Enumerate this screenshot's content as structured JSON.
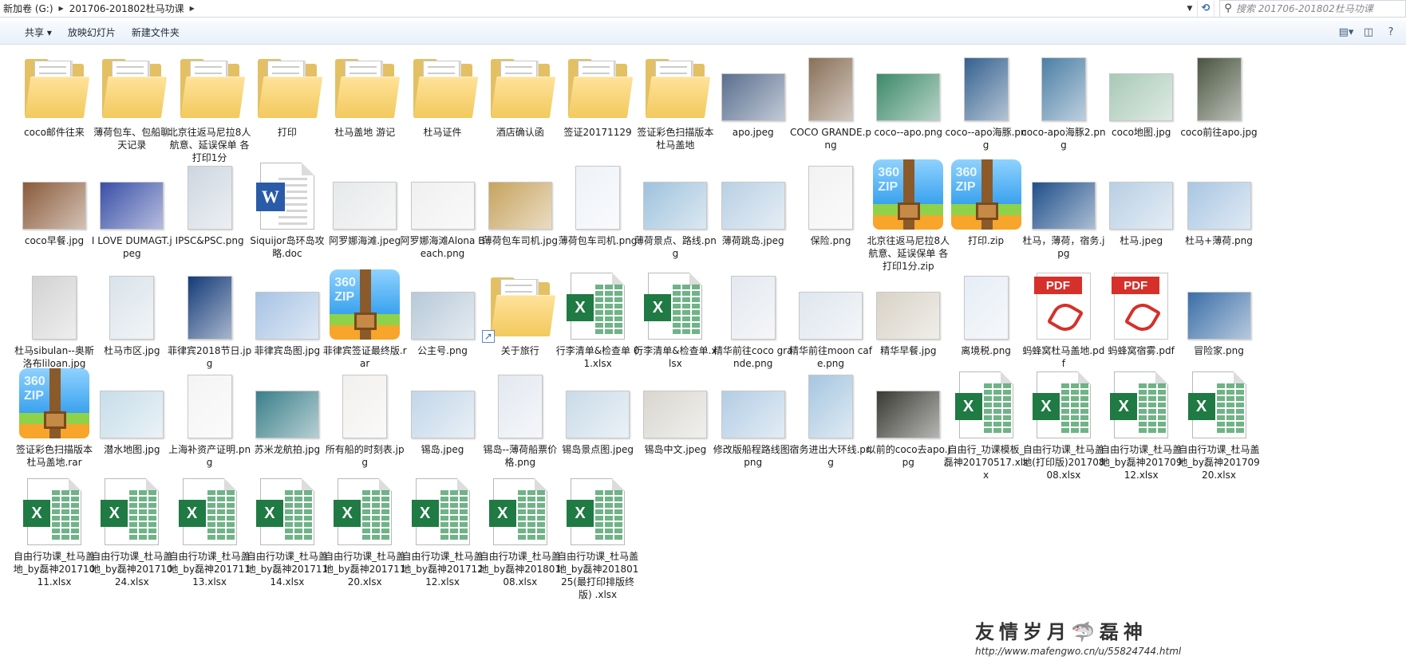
{
  "address": {
    "crumbs": [
      "新加卷 (G:)",
      "201706-201802杜马功课"
    ],
    "search_placeholder": "搜索 201706-201802杜马功课"
  },
  "toolbar": {
    "share": "共享 ▾",
    "slideshow": "放映幻灯片",
    "new_folder": "新建文件夹"
  },
  "items": [
    {
      "label": "coco邮件往来",
      "type": "folder"
    },
    {
      "label": "薄荷包车、包船聊天记录",
      "type": "folder"
    },
    {
      "label": "北京往返马尼拉8人 航意、延误保单 各打印1分",
      "type": "folder"
    },
    {
      "label": "打印",
      "type": "folder"
    },
    {
      "label": "杜马盖地 游记",
      "type": "folder"
    },
    {
      "label": "杜马证件",
      "type": "folder"
    },
    {
      "label": "酒店确认函",
      "type": "folder"
    },
    {
      "label": "签证20171129",
      "type": "folder"
    },
    {
      "label": "签证彩色扫描版本 杜马盖地",
      "type": "folder"
    },
    {
      "label": "apo.jpeg",
      "type": "image",
      "color": "#5a6f8f"
    },
    {
      "label": "COCO GRANDE.png",
      "type": "image",
      "color": "#8a7058",
      "tall": true
    },
    {
      "label": "coco--apo.png",
      "type": "image",
      "color": "#3d8a6a"
    },
    {
      "label": "coco--apo海豚.png",
      "type": "image",
      "color": "#35618f",
      "tall": true
    },
    {
      "label": "coco-apo海豚2.png",
      "type": "image",
      "color": "#4c7fa6",
      "tall": true
    },
    {
      "label": "coco地图.jpg",
      "type": "image",
      "color": "#a8c9b6"
    },
    {
      "label": "coco前往apo.jpg",
      "type": "image",
      "color": "#4a5540",
      "tall": true
    },
    {
      "label": "coco早餐.jpg",
      "type": "image",
      "color": "#8a5a3a"
    },
    {
      "label": "I LOVE DUMAGT.jpeg",
      "type": "image",
      "color": "#3a4fa8"
    },
    {
      "label": "IPSC&PSC.png",
      "type": "image",
      "color": "#cdd6e0",
      "tall": true
    },
    {
      "label": "Siquijor岛环岛攻略.doc",
      "type": "word"
    },
    {
      "label": "阿罗娜海滩.jpeg",
      "type": "image",
      "color": "#e6e9ea"
    },
    {
      "label": "阿罗娜海滩Alona Beach.png",
      "type": "image",
      "color": "#f0f0f0"
    },
    {
      "label": "薄荷包车司机.jpg",
      "type": "image",
      "color": "#c7a35e"
    },
    {
      "label": "薄荷包车司机.png",
      "type": "image",
      "color": "#eef2f8",
      "tall": true
    },
    {
      "label": "薄荷景点、路线.png",
      "type": "image",
      "color": "#9fc2dd"
    },
    {
      "label": "薄荷跳岛.jpeg",
      "type": "image",
      "color": "#b9d0e4"
    },
    {
      "label": "保险.png",
      "type": "image",
      "color": "#f2f2f2",
      "tall": true
    },
    {
      "label": "北京往返马尼拉8人 航意、延误保单 各打印1分.zip",
      "type": "zip"
    },
    {
      "label": "打印.zip",
      "type": "zip"
    },
    {
      "label": "杜马，薄荷，宿务.jpg",
      "type": "image",
      "color": "#1f4f8a"
    },
    {
      "label": "杜马.jpeg",
      "type": "image",
      "color": "#b8cfe4"
    },
    {
      "label": "杜马+薄荷.png",
      "type": "image",
      "color": "#a9c6e2"
    },
    {
      "label": "杜马sibulan--奥斯洛布liloan.jpg",
      "type": "image",
      "color": "#d2d2d2",
      "tall": true
    },
    {
      "label": "杜马市区.jpg",
      "type": "image",
      "color": "#d9e3ea",
      "tall": true
    },
    {
      "label": "菲律宾2018节日.jpg",
      "type": "image",
      "color": "#143b78",
      "tall": true
    },
    {
      "label": "菲律宾岛图.jpg",
      "type": "image",
      "color": "#a7c3e4"
    },
    {
      "label": "菲律宾签证最终版.rar",
      "type": "zip"
    },
    {
      "label": "公主号.png",
      "type": "image",
      "color": "#b7c9d8"
    },
    {
      "label": "关于旅行",
      "type": "folder",
      "shortcut": true
    },
    {
      "label": "行李清单&检查单 01.xlsx",
      "type": "excel"
    },
    {
      "label": "行李清单&检查单.xlsx",
      "type": "excel"
    },
    {
      "label": "精华前往coco grande.png",
      "type": "image",
      "color": "#e4e8ef",
      "tall": true
    },
    {
      "label": "精华前往moon cafe.png",
      "type": "image",
      "color": "#dfe6ee"
    },
    {
      "label": "精华早餐.jpg",
      "type": "image",
      "color": "#d8d2c6"
    },
    {
      "label": "离境税.png",
      "type": "image",
      "color": "#e6edf5",
      "tall": true
    },
    {
      "label": "蚂蜂窝杜马盖地.pdf",
      "type": "pdf"
    },
    {
      "label": "蚂蜂窝宿雾.pdf",
      "type": "pdf"
    },
    {
      "label": "冒险家.png",
      "type": "image",
      "color": "#3b6ea8"
    },
    {
      "label": "签证彩色扫描版本 杜马盖地.rar",
      "type": "zip"
    },
    {
      "label": "潜水地图.jpg",
      "type": "image",
      "color": "#c7dde9"
    },
    {
      "label": "上海补资产证明.png",
      "type": "image",
      "color": "#f4f4f4",
      "tall": true
    },
    {
      "label": "苏米龙航拍.jpg",
      "type": "image",
      "color": "#3a7f8a"
    },
    {
      "label": "所有船的时刻表.jpg",
      "type": "image",
      "color": "#f2f0ee",
      "tall": true
    },
    {
      "label": "锡岛.jpeg",
      "type": "image",
      "color": "#c2d6e8"
    },
    {
      "label": "锡岛--薄荷船票价格.png",
      "type": "image",
      "color": "#e3e8f0",
      "tall": true
    },
    {
      "label": "锡岛景点图.jpeg",
      "type": "image",
      "color": "#c9dbe8"
    },
    {
      "label": "锡岛中文.jpeg",
      "type": "image",
      "color": "#d9d6cf"
    },
    {
      "label": "修改版船程路线图.png",
      "type": "image",
      "color": "#b3cde4"
    },
    {
      "label": "宿务进出大环线.png",
      "type": "image",
      "color": "#a6c6e0",
      "tall": true
    },
    {
      "label": "以前的coco去apo.jpg",
      "type": "image",
      "color": "#3a3a34"
    },
    {
      "label": "自由行_功课模板_磊神20170517.xlsx",
      "type": "excel"
    },
    {
      "label": "自由行功课_杜马盖地(打印版)20170808.xlsx",
      "type": "excel"
    },
    {
      "label": "自由行功课_杜马盖地_by磊神20170912.xlsx",
      "type": "excel"
    },
    {
      "label": "自由行功课_杜马盖地_by磊神20170920.xlsx",
      "type": "excel"
    },
    {
      "label": "自由行功课_杜马盖地_by磊神20171011.xlsx",
      "type": "excel"
    },
    {
      "label": "自由行功课_杜马盖地_by磊神20171024.xlsx",
      "type": "excel"
    },
    {
      "label": "自由行功课_杜马盖地_by磊神20171113.xlsx",
      "type": "excel"
    },
    {
      "label": "自由行功课_杜马盖地_by磊神20171114.xlsx",
      "type": "excel"
    },
    {
      "label": "自由行功课_杜马盖地_by磊神20171120.xlsx",
      "type": "excel"
    },
    {
      "label": "自由行功课_杜马盖地_by磊神20171212.xlsx",
      "type": "excel"
    },
    {
      "label": "自由行功课_杜马盖地_by磊神20180108.xlsx",
      "type": "excel"
    },
    {
      "label": "自由行功课_杜马盖地_by磊神20180125(最打印排版终版) .xlsx",
      "type": "excel"
    }
  ],
  "watermark": {
    "title": "友情岁月🦈磊神",
    "url": "http://www.mafengwo.cn/u/55824744.html"
  }
}
